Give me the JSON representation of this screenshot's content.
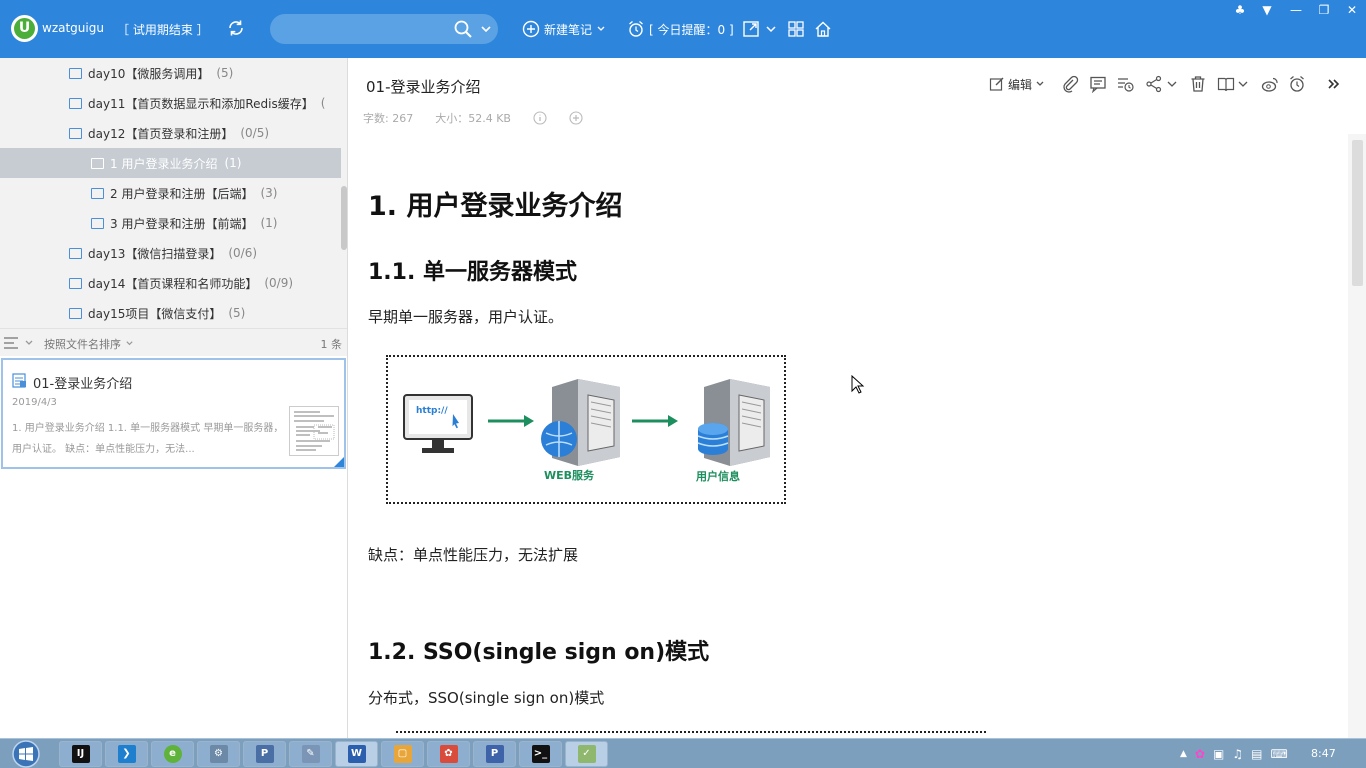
{
  "topbar": {
    "logo_letter": "U",
    "username": "wzatguigu",
    "trial": "［ 试用期结束 ］",
    "search_placeholder": "",
    "new_note": "新建笔记",
    "reminder": "[ 今日提醒：0 ]",
    "colors": {
      "bar": "#2e86dc",
      "search": "#5aa2e4"
    }
  },
  "tree": {
    "items": [
      {
        "name": "day10【微服务调用】",
        "count": "(5)"
      },
      {
        "name": "day11【首页数据显示和添加Redis缓存】",
        "count": "("
      },
      {
        "name": "day12【首页登录和注册】",
        "count": "(0/5)"
      },
      {
        "name": "1 用户登录业务介绍",
        "count": "(1)"
      },
      {
        "name": "2 用户登录和注册【后端】",
        "count": "(3)"
      },
      {
        "name": "3 用户登录和注册【前端】",
        "count": "(1)"
      },
      {
        "name": "day13【微信扫描登录】",
        "count": "(0/6)"
      },
      {
        "name": "day14【首页课程和名师功能】",
        "count": "(0/9)"
      },
      {
        "name": "day15项目【微信支付】",
        "count": "(5)"
      }
    ]
  },
  "sortbar": {
    "label": "按照文件名排序",
    "count": "1 条"
  },
  "note_card": {
    "title": "01-登录业务介绍",
    "date": "2019/4/3",
    "snippet": "1. 用户登录业务介绍 1.1. 单一服务器模式 早期单一服务器，用户认证。 缺点：单点性能压力，无法..."
  },
  "note": {
    "title": "01-登录业务介绍",
    "word_count": "字数: 267",
    "size": "大小：52.4 KB",
    "edit_label": "编辑"
  },
  "content": {
    "h1": "1.   用户登录业务介绍",
    "h2_1": "1.1. 单一服务器模式",
    "p1": "早期单一服务器，用户认证。",
    "diagram": {
      "http": "http://",
      "web": "WEB服务",
      "user": "用户信息"
    },
    "p2": "缺点：单点性能压力，无法扩展",
    "h2_2": "1.2. SSO(single sign on)模式",
    "p3": "分布式，SSO(single sign on)模式"
  },
  "taskbar": {
    "time": "8:47"
  }
}
